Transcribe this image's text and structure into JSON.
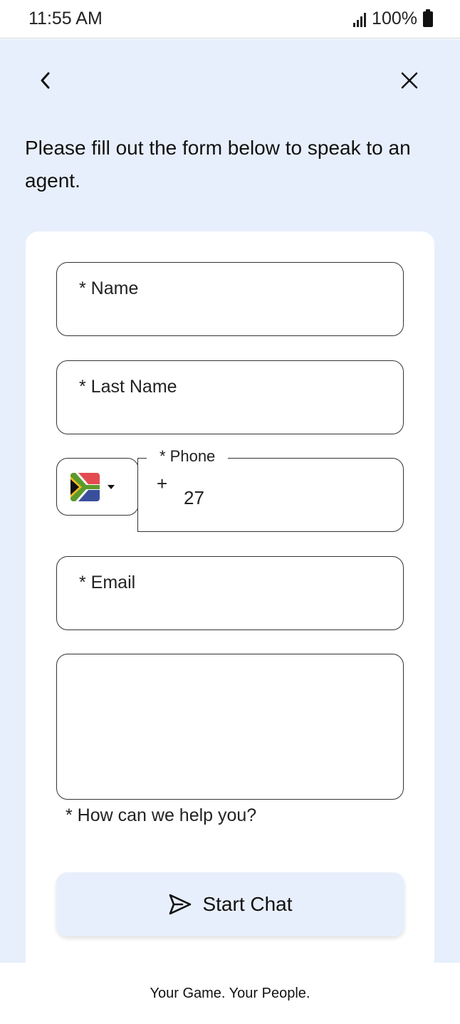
{
  "status_bar": {
    "time": "11:55 AM",
    "battery": "100%"
  },
  "header": {
    "back_icon": "chevron-left-icon",
    "close_icon": "close-icon"
  },
  "intro": {
    "text": "Please fill out the form below to speak to an agent."
  },
  "form": {
    "name_label": "* Name",
    "last_name_label": "* Last Name",
    "phone": {
      "label": "* Phone",
      "country": "South Africa",
      "prefix": "+",
      "code": "27"
    },
    "email_label": "* Email",
    "help_label": "* How can we help you?",
    "submit": {
      "label": "Start Chat",
      "icon": "send-icon"
    }
  },
  "footer": {
    "tagline": "Your Game. Your People."
  },
  "colors": {
    "background": "#e8effc",
    "card": "#ffffff",
    "border": "#333333",
    "button": "#e8effc"
  }
}
